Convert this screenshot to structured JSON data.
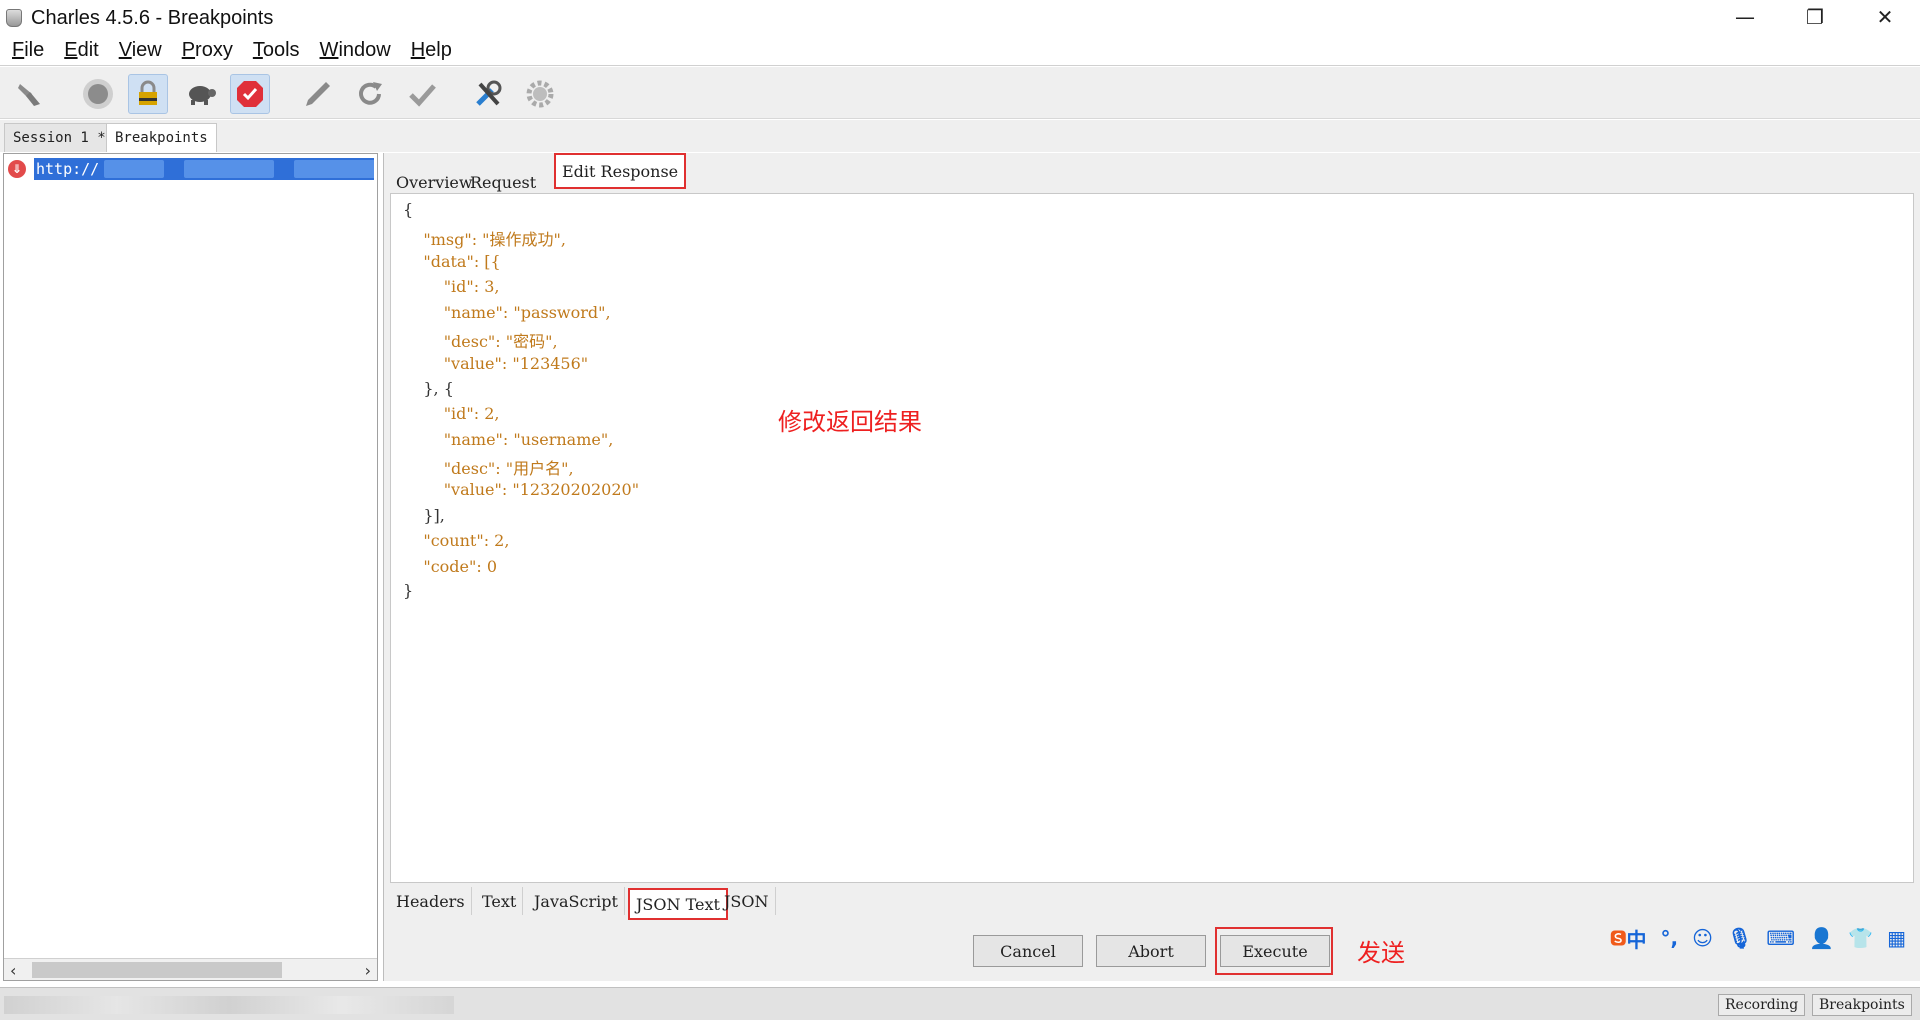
{
  "window": {
    "title": "Charles 4.5.6 - Breakpoints",
    "controls": {
      "minimize": "—",
      "restore": "❐",
      "close": "✕"
    }
  },
  "menu": {
    "items": [
      {
        "label": "File",
        "u": "F"
      },
      {
        "label": "Edit",
        "u": "E"
      },
      {
        "label": "View",
        "u": "V"
      },
      {
        "label": "Proxy",
        "u": "P"
      },
      {
        "label": "Tools",
        "u": "T"
      },
      {
        "label": "Window",
        "u": "W"
      },
      {
        "label": "Help",
        "u": "H"
      }
    ]
  },
  "toolbar": {
    "icons": [
      "broom-icon",
      "record-icon",
      "ssl-lock-icon",
      "throttle-turtle-icon",
      "breakpoints-icon",
      "pen-icon",
      "refresh-icon",
      "validate-check-icon",
      "tools-icon",
      "settings-gear-icon"
    ]
  },
  "session_tabs": [
    {
      "label": "Session 1 *"
    },
    {
      "label": "Breakpoints"
    }
  ],
  "tree": {
    "url": "http://"
  },
  "panel_tabs": [
    {
      "label": "Overview"
    },
    {
      "label": "Request"
    },
    {
      "label": "Edit Response"
    }
  ],
  "json_lines": [
    "{",
    "    \"msg\": \"操作成功\",",
    "    \"data\": [{",
    "        \"id\": 3,",
    "        \"name\": \"password\",",
    "        \"desc\": \"密码\",",
    "        \"value\": \"123456\"",
    "    }, {",
    "        \"id\": 2,",
    "        \"name\": \"username\",",
    "        \"desc\": \"用户名\",",
    "        \"value\": \"12320202020\"",
    "    }],",
    "    \"count\": 2,",
    "    \"code\": 0",
    "}"
  ],
  "annotations": {
    "modify": "修改返回结果",
    "send": "发送"
  },
  "bottom_tabs": [
    {
      "label": "Headers"
    },
    {
      "label": "Text"
    },
    {
      "label": "JavaScript"
    },
    {
      "label": "JSON Text"
    },
    {
      "label": "JSON"
    }
  ],
  "buttons": {
    "cancel": "Cancel",
    "abort": "Abort",
    "execute": "Execute"
  },
  "status": {
    "recording": "Recording",
    "breakpoints": "Breakpoints"
  },
  "ime": {
    "lang": "中",
    "punct": "°,"
  },
  "colors": {
    "accent_red": "#e03030",
    "selection_blue": "#2f6fd8",
    "json_key": "#c07a1c",
    "json_number": "#8a9a1a"
  }
}
